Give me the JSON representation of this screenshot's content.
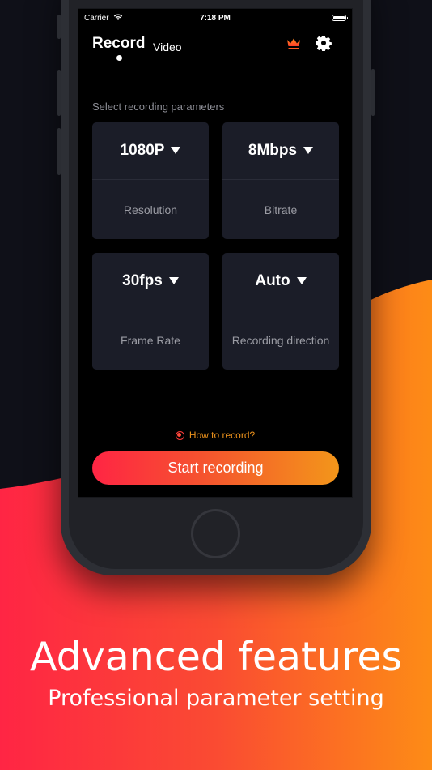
{
  "colors": {
    "background_dark": "#0f1018",
    "gradient_start": "#ff2544",
    "gradient_end": "#f99017",
    "card_bg": "#1b1d28",
    "accent_orange": "#e9901c",
    "record_red": "#ff3b3b"
  },
  "status_bar": {
    "carrier": "Carrier",
    "wifi_icon": "wifi-icon",
    "time": "7:18 PM",
    "battery_icon": "battery-icon"
  },
  "nav": {
    "tabs": [
      {
        "label": "Record",
        "active": true
      },
      {
        "label": "Video",
        "active": false
      }
    ],
    "crown_icon": "crown-icon",
    "settings_icon": "gear-icon"
  },
  "main": {
    "section_label": "Select recording parameters",
    "params": [
      {
        "value": "1080P",
        "label": "Resolution"
      },
      {
        "value": "8Mbps",
        "label": "Bitrate"
      },
      {
        "value": "30fps",
        "label": "Frame Rate"
      },
      {
        "value": "Auto",
        "label": "Recording direction"
      }
    ],
    "howto_link": "How to record?",
    "start_button": "Start recording"
  },
  "promo": {
    "headline": "Advanced features",
    "subline": "Professional parameter setting"
  }
}
